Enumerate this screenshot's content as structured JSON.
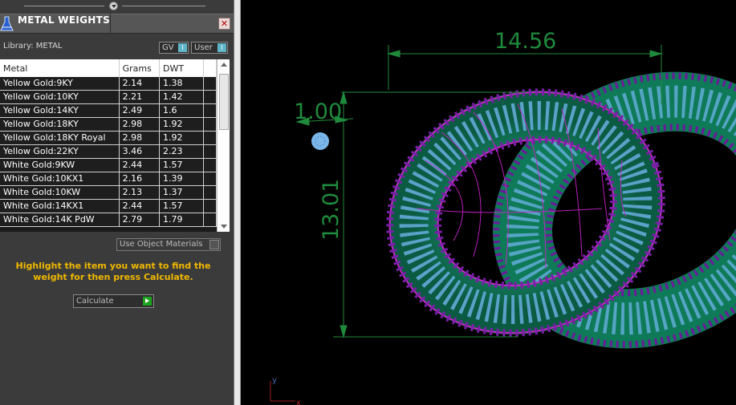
{
  "panel": {
    "title": "METAL WEIGHTS",
    "close_glyph": "✕",
    "library_label": "Library: METAL",
    "gv_label": "GV",
    "user_label": "User",
    "toggle_glyph": "I",
    "columns": [
      "Metal",
      "Grams",
      "DWT"
    ],
    "rows": [
      {
        "metal": "Yellow Gold:9KY",
        "grams": "2.14",
        "dwt": "1.38"
      },
      {
        "metal": "Yellow Gold:10KY",
        "grams": "2.21",
        "dwt": "1.42"
      },
      {
        "metal": "Yellow Gold:14KY",
        "grams": "2.49",
        "dwt": "1.6"
      },
      {
        "metal": "Yellow Gold:18KY",
        "grams": "2.98",
        "dwt": "1.92"
      },
      {
        "metal": "Yellow Gold:18KY Royal",
        "grams": "2.98",
        "dwt": "1.92"
      },
      {
        "metal": "Yellow Gold:22KY",
        "grams": "3.46",
        "dwt": "2.23"
      },
      {
        "metal": "White Gold:9KW",
        "grams": "2.44",
        "dwt": "1.57"
      },
      {
        "metal": "White Gold:10KX1",
        "grams": "2.16",
        "dwt": "1.39"
      },
      {
        "metal": "White Gold:10KW",
        "grams": "2.13",
        "dwt": "1.37"
      },
      {
        "metal": "White Gold:14KX1",
        "grams": "2.44",
        "dwt": "1.57"
      },
      {
        "metal": "White Gold:14K PdW",
        "grams": "2.79",
        "dwt": "1.79"
      }
    ],
    "use_object_materials": "Use Object Materials",
    "instructions": "Highlight the item you want to find the weight for then press Calculate.",
    "calculate_label": "Calculate",
    "icons": {
      "panel_icon": "flask-icon",
      "close": "close-icon",
      "collapse": "chevron-down-icon",
      "calculate_go": "play-icon"
    }
  },
  "viewport": {
    "dim_width": "14.56",
    "dim_height": "13.01",
    "dim_stone": "1.00",
    "axis_y": "y",
    "axis_x": "x",
    "colors": {
      "dimension": "#1f8a3c",
      "wireframe": "#cc22cc",
      "metal": "#1e9a72",
      "stones": "#7ab6e8",
      "prongs": "#7a1fa8"
    }
  }
}
